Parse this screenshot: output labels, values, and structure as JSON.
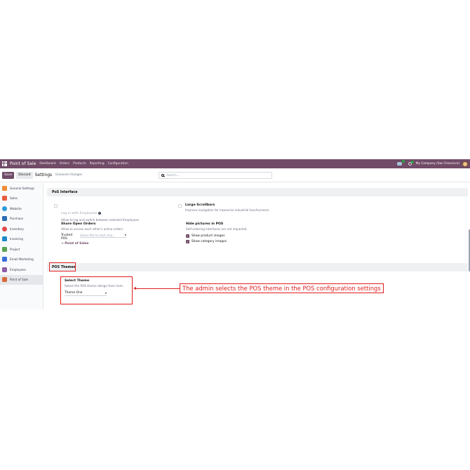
{
  "navbar": {
    "app_name": "Point of Sale",
    "menu": [
      "Dashboard",
      "Orders",
      "Products",
      "Reporting",
      "Configuration"
    ],
    "company": "My Company (San Francisco)",
    "chat_icon": "chat-icon",
    "activity_icon": "clock-icon"
  },
  "control": {
    "save_label": "Save",
    "discard_label": "Discard",
    "breadcrumb": "Settings",
    "status": "Unsaved changes",
    "search_placeholder": "Search..."
  },
  "sidebar": {
    "items": [
      {
        "label": "General Settings",
        "icon": "settings-icon",
        "color": "#f08c3a"
      },
      {
        "label": "Sales",
        "icon": "sales-icon",
        "color": "#e85d3f"
      },
      {
        "label": "Website",
        "icon": "website-icon",
        "color": "#2d9bdb"
      },
      {
        "label": "Purchase",
        "icon": "purchase-icon",
        "color": "#2b6cb0"
      },
      {
        "label": "Inventory",
        "icon": "inventory-icon",
        "color": "#e24b4b"
      },
      {
        "label": "Invoicing",
        "icon": "invoicing-icon",
        "color": "#1e88c8"
      },
      {
        "label": "Project",
        "icon": "project-icon",
        "color": "#5aa454"
      },
      {
        "label": "Email Marketing",
        "icon": "email-marketing-icon",
        "color": "#3b6fd8"
      },
      {
        "label": "Employees",
        "icon": "employees-icon",
        "color": "#8e5fa8"
      },
      {
        "label": "Point of Sale",
        "icon": "pos-icon",
        "color": "#d96b3b"
      }
    ]
  },
  "main": {
    "pos_interface": {
      "header": "PoS Interface",
      "login_employees": {
        "title": "Log in with Employees",
        "desc": "Allow to log and switch between selected Employees"
      },
      "large_scrollbars": {
        "title": "Large Scrollbars",
        "desc": "Improve navigation for imprecise industrial touchscreens"
      },
      "share_orders": {
        "title": "Share Open Orders",
        "desc": "Allow to access each other's active orders",
        "trusted_label": "Trusted POS",
        "trusted_placeholder": "Select PoS to start shar...",
        "link": "→ Point of Sales"
      },
      "hide_pictures": {
        "title": "Hide pictures in POS",
        "desc": "Self-ordering interfaces are not impacted.",
        "options": [
          "Show product images",
          "Show category images"
        ]
      }
    },
    "pos_themes": {
      "header": "POS Themes",
      "select_theme": {
        "title": "Select Theme",
        "desc": "Select the POS theme design from here.",
        "value": "Theme One"
      }
    }
  },
  "annotation": {
    "text": "The admin selects the POS theme in the POS configuration settings",
    "color": "#e11d1d"
  }
}
